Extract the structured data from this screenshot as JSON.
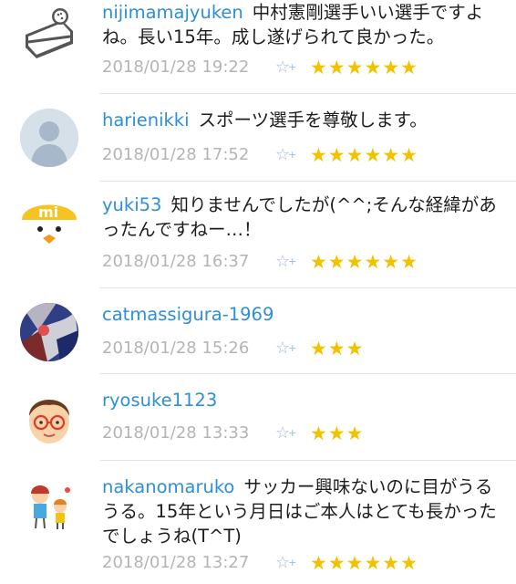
{
  "comments": [
    {
      "user": "nijimamajyuken",
      "text": "中村憲剛選手いい選手ですよね。長い15年。成し遂げられて良かった。",
      "timestamp": "2018/01/28 19:22",
      "stars": "★★★★★★",
      "avatar": "cake-avatar"
    },
    {
      "user": "harienikki",
      "text": "スポーツ選手を尊敬します。",
      "timestamp": "2018/01/28 17:52",
      "stars": "★★★★★★",
      "avatar": "default-person-avatar"
    },
    {
      "user": "yuki53",
      "text": "知りませんでしたが(^^;そんな経緯があったんですねー…！",
      "timestamp": "2018/01/28 16:37",
      "stars": "★★★★★★",
      "avatar": "mi-duck-avatar"
    },
    {
      "user": "catmassigura-1969",
      "text": "",
      "timestamp": "2018/01/28 15:26",
      "stars": "★★★",
      "avatar": "photo-avatar"
    },
    {
      "user": "ryosuke1123",
      "text": "",
      "timestamp": "2018/01/28 13:33",
      "stars": "★★★",
      "avatar": "glasses-boy-avatar"
    },
    {
      "user": "nakanomaruko",
      "text": "サッカー興味ないのに目がうるうる。15年という月日はご本人はとても長かったでしょうね(T^T)",
      "timestamp": "2018/01/28 13:27",
      "stars": "★★★★★★",
      "avatar": "kids-avatar"
    }
  ],
  "star_button": {
    "icon": "☆",
    "plus": "+"
  },
  "colors": {
    "username": "#2d8fd6",
    "star": "#f2c200",
    "add_star": "#9bbce0",
    "timestamp": "#b4b4b4"
  }
}
